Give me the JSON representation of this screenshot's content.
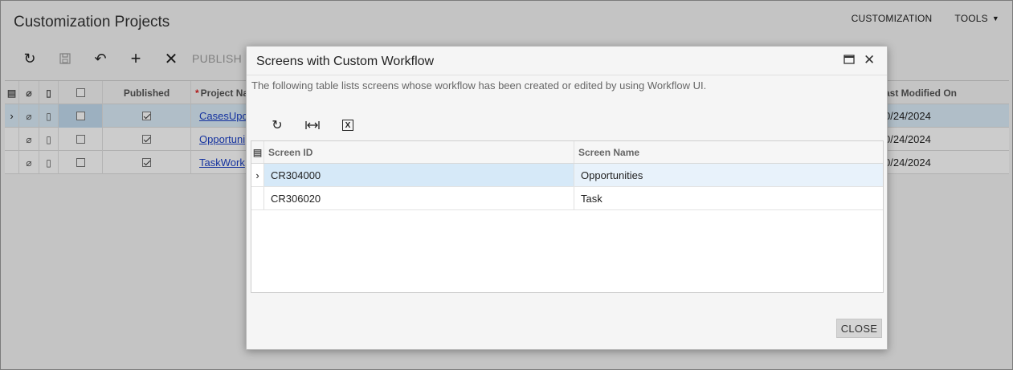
{
  "page": {
    "title": "Customization Projects",
    "top_links": {
      "customization": "CUSTOMIZATION",
      "tools": "TOOLS"
    }
  },
  "toolbar": {
    "publish_label": "PUBLISH"
  },
  "grid": {
    "headers": {
      "published": "Published",
      "project_name": "Project Na",
      "last_modified": "ast Modified On"
    },
    "rows": [
      {
        "project": "CasesUpc",
        "published": true,
        "modified": "0/24/2024",
        "selected": true
      },
      {
        "project": "Opportuni",
        "published": true,
        "modified": "0/24/2024",
        "selected": false
      },
      {
        "project": "TaskWork",
        "published": true,
        "modified": "0/24/2024",
        "selected": false
      }
    ]
  },
  "modal": {
    "title": "Screens with Custom Workflow",
    "description": "The following table lists screens whose workflow has been created or edited by using Workflow UI.",
    "columns": {
      "screen_id": "Screen ID",
      "screen_name": "Screen Name"
    },
    "rows": [
      {
        "screen_id": "CR304000",
        "screen_name": "Opportunities"
      },
      {
        "screen_id": "CR306020",
        "screen_name": "Task"
      }
    ],
    "close_label": "CLOSE"
  }
}
